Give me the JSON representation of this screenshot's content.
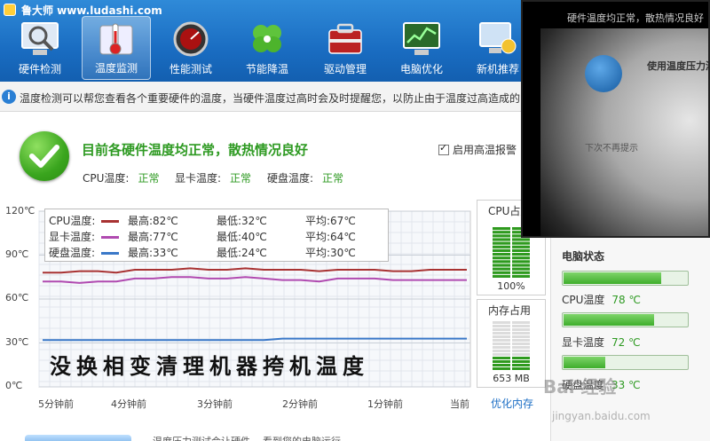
{
  "app": {
    "title": "鲁大师 www.ludashi.com"
  },
  "nav": [
    {
      "label": "硬件检测",
      "icon": "magnifier-monitor-icon"
    },
    {
      "label": "温度监测",
      "icon": "thermometer-icon",
      "active": true
    },
    {
      "label": "性能测试",
      "icon": "speedometer-icon"
    },
    {
      "label": "节能降温",
      "icon": "clover-icon"
    },
    {
      "label": "驱动管理",
      "icon": "toolbox-icon"
    },
    {
      "label": "电脑优化",
      "icon": "monitor-chart-icon"
    },
    {
      "label": "新机推荐",
      "icon": "computer-medal-icon"
    }
  ],
  "info": {
    "text": "温度检测可以帮您查看各个重要硬件的温度，当硬件温度过高时会及时提醒您，以防止由于温度过高造成的"
  },
  "status": {
    "title": "目前各硬件温度均正常，散热情况良好",
    "items": [
      {
        "label": "CPU温度:",
        "value": "正常"
      },
      {
        "label": "显卡温度:",
        "value": "正常"
      },
      {
        "label": "硬盘温度:",
        "value": "正常"
      }
    ],
    "alarm_label": "启用高温报警",
    "alarm_checked": true
  },
  "chart_data": {
    "type": "line",
    "ylim": [
      0,
      120
    ],
    "y_ticks": [
      "120℃",
      "90℃",
      "60℃",
      "30℃",
      "0℃"
    ],
    "x_ticks": [
      "5分钟前",
      "4分钟前",
      "3分钟前",
      "2分钟前",
      "1分钟前",
      "当前"
    ],
    "grid": true,
    "legend_position": "top-left",
    "series": [
      {
        "name": "CPU温度:",
        "color": "#a83232",
        "max": "最高:82℃",
        "min": "最低:32℃",
        "avg": "平均:67℃",
        "values": [
          78,
          78,
          79,
          79,
          78,
          80,
          80,
          80,
          81,
          80,
          80,
          81,
          80,
          80,
          80,
          79,
          80,
          80,
          80,
          79,
          79,
          80,
          80,
          80
        ]
      },
      {
        "name": "显卡温度:",
        "color": "#b04ab0",
        "max": "最高:77℃",
        "min": "最低:40℃",
        "avg": "平均:64℃",
        "values": [
          72,
          72,
          71,
          72,
          72,
          74,
          74,
          75,
          75,
          74,
          74,
          75,
          74,
          73,
          73,
          72,
          74,
          74,
          74,
          73,
          73,
          73,
          73,
          73
        ]
      },
      {
        "name": "硬盘温度:",
        "color": "#3a78c8",
        "max": "最高:33℃",
        "min": "最低:24℃",
        "avg": "平均:30℃",
        "values": [
          32,
          32,
          32,
          32,
          32,
          32,
          32,
          32,
          32,
          32,
          32,
          32,
          32,
          33,
          33,
          33,
          33,
          33,
          33,
          33,
          33,
          33,
          33,
          33
        ]
      }
    ]
  },
  "annotation": "没换相变清理机器挎机温度",
  "meters": {
    "cpu": {
      "title": "CPU占用",
      "percent": 100,
      "label": "100%"
    },
    "mem": {
      "title": "内存占用",
      "percent": 30,
      "label": "653 MB"
    },
    "optimize_link": "优化内存"
  },
  "pc_status": {
    "title": "电脑状态",
    "items": [
      {
        "label": "CPU温度",
        "value": "78 ℃",
        "fill": 0.78
      },
      {
        "label": "显卡温度",
        "value": "72 ℃",
        "fill": 0.72
      },
      {
        "label": "硬盘温度",
        "value": "33 ℃",
        "fill": 0.33
      }
    ]
  },
  "overlay": {
    "caption": "硬件温度均正常，散热情况良好",
    "dialog_title": "使用温度压力测",
    "checkbox_text": "下次不再提示"
  },
  "bottom": {
    "text": "温度压力测试会让硬件... 看到您的电脑运行..."
  },
  "watermark": {
    "text": "Bai 经验",
    "url": "jingyan.baidu.com"
  }
}
